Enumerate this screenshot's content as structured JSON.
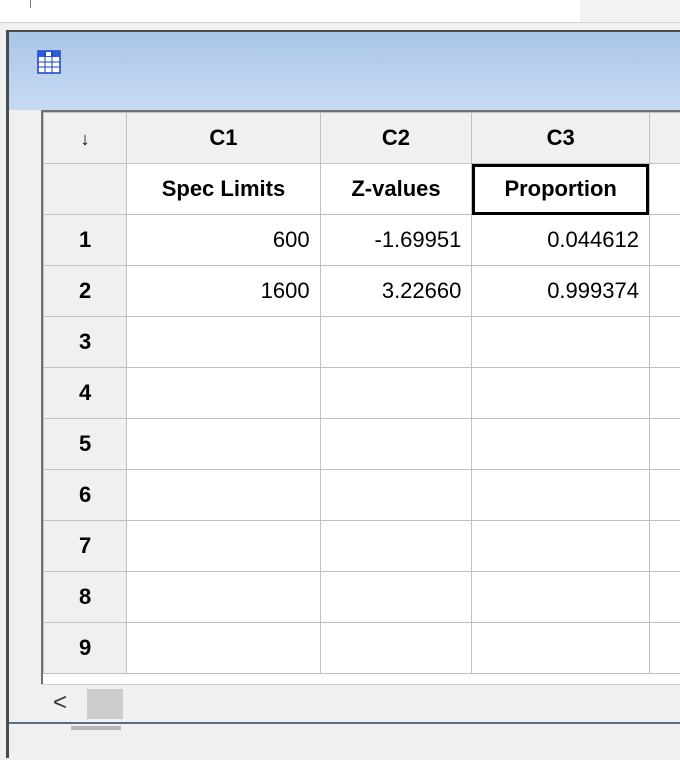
{
  "worksheet": {
    "icon": "worksheet-grid-icon",
    "columns": [
      {
        "id": "C1",
        "name": "Spec Limits"
      },
      {
        "id": "C2",
        "name": "Z-values"
      },
      {
        "id": "C3",
        "name": "Proportion"
      }
    ],
    "sort_indicator": "↓",
    "rows": [
      {
        "num": "1",
        "c1": "600",
        "c2": "-1.69951",
        "c3": "0.044612"
      },
      {
        "num": "2",
        "c1": "1600",
        "c2": "3.22660",
        "c3": "0.999374"
      },
      {
        "num": "3",
        "c1": "",
        "c2": "",
        "c3": ""
      },
      {
        "num": "4",
        "c1": "",
        "c2": "",
        "c3": ""
      },
      {
        "num": "5",
        "c1": "",
        "c2": "",
        "c3": ""
      },
      {
        "num": "6",
        "c1": "",
        "c2": "",
        "c3": ""
      },
      {
        "num": "7",
        "c1": "",
        "c2": "",
        "c3": ""
      },
      {
        "num": "8",
        "c1": "",
        "c2": "",
        "c3": ""
      },
      {
        "num": "9",
        "c1": "",
        "c2": "",
        "c3": ""
      }
    ],
    "scroll_left": "<"
  },
  "colors": {
    "titlebar": "#bcd2ee",
    "header_bg": "#f0f0f0",
    "grid_line": "#c0c0c0"
  }
}
